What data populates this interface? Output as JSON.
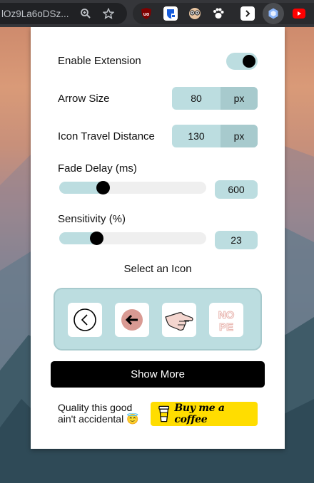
{
  "browser": {
    "url_text": "lOz9La6oDSz...",
    "icons": [
      "zoom-icon",
      "bookmark-star-icon"
    ],
    "extensions": [
      {
        "name": "ublock-origin-icon",
        "label": "uo",
        "color": "#800000"
      },
      {
        "name": "bitwarden-icon",
        "label": "",
        "color": "#175ddc"
      },
      {
        "name": "glasses-face-icon",
        "label": "",
        "color": "#888"
      },
      {
        "name": "paw-icon",
        "label": "",
        "color": "#fff"
      },
      {
        "name": "terminal-arrow-icon",
        "label": "",
        "color": "#fff"
      },
      {
        "name": "hexagon-extension-icon",
        "label": "",
        "color": "#8ab4f8"
      },
      {
        "name": "youtube-icon",
        "label": "",
        "color": "#ff0000"
      }
    ]
  },
  "popup": {
    "enable_label": "Enable Extension",
    "enable_on": true,
    "arrow_size_label": "Arrow Size",
    "arrow_size_value": "80",
    "arrow_size_unit": "px",
    "travel_label": "Icon Travel Distance",
    "travel_value": "130",
    "travel_unit": "px",
    "fade_label": "Fade Delay (ms)",
    "fade_value": "600",
    "fade_fraction": 0.28,
    "sensitivity_label": "Sensitivity (%)",
    "sensitivity_value": "23",
    "sensitivity_fraction": 0.23,
    "select_icon_label": "Select an Icon",
    "icons": [
      "circle-chevron-left-icon",
      "arrow-left-icon",
      "pointing-hand-icon",
      "nope-text-icon"
    ],
    "nope_text": "NOPE",
    "show_more_label": "Show More",
    "quality_text": "Quality this good ain't accidental 😇",
    "coffee_label": "Buy me a coffee",
    "accent_color": "#bcdde0",
    "accent_dark": "#a7cacd"
  }
}
